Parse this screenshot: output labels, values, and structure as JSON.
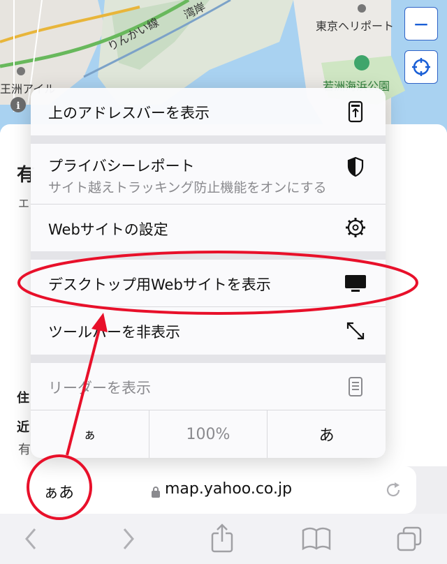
{
  "map": {
    "labels": {
      "rinkai": "りんかい線",
      "wangan": "湾岸",
      "heliport": "東京ヘリポート",
      "park": "若洲海浜公園",
      "ward": "王洲アイル"
    },
    "zoom_out_symbol": "−",
    "locate_symbol": "⌖"
  },
  "page_fragments": {
    "title_char": "有",
    "sub_char": "エ",
    "left_1": "住",
    "left_2": "近",
    "left_3": "有"
  },
  "menu": {
    "show_top_address_bar": "上のアドレスバーを表示",
    "privacy_report": "プライバシーレポート",
    "privacy_report_sub": "サイト越えトラッキング防止機能をオンにする",
    "website_settings": "Webサイトの設定",
    "request_desktop": "デスクトップ用Webサイトを表示",
    "hide_toolbar": "ツールバーを非表示",
    "show_reader": "リーダーを表示",
    "zoom_small": "ぁ",
    "zoom_level": "100%",
    "zoom_large": "あ"
  },
  "address_bar": {
    "aa_label": "ぁあ",
    "url": "map.yahoo.co.jp"
  },
  "colors": {
    "annotation": "#e8102a",
    "map_water": "#a9d2f1",
    "accent": "#1a5fd6"
  }
}
